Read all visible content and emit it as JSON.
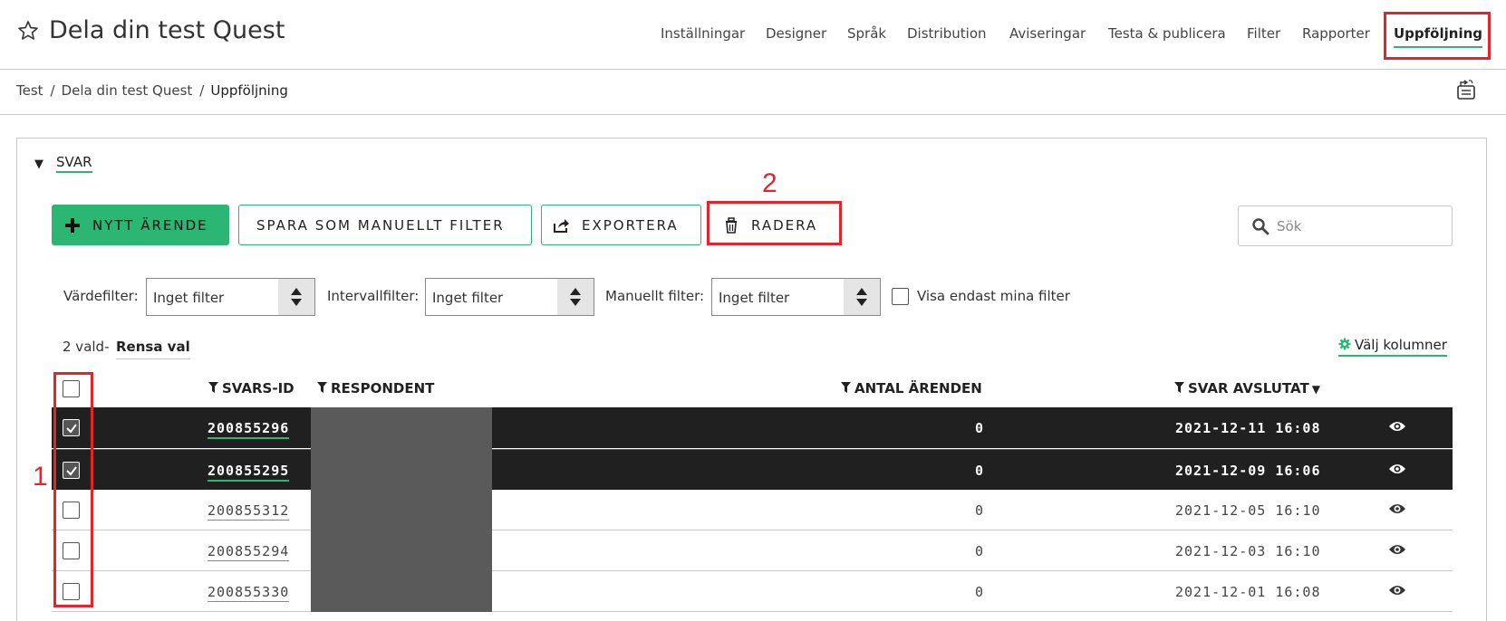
{
  "header": {
    "title": "Dela din test Quest",
    "nav": [
      "Inställningar",
      "Designer",
      "Språk",
      "Distribution",
      "Aviseringar",
      "Testa & publicera",
      "Filter",
      "Rapporter",
      "Uppföljning"
    ],
    "active_nav": "Uppföljning"
  },
  "breadcrumb": [
    "Test",
    "Dela din test Quest",
    "Uppföljning"
  ],
  "breadcrumb_separator": "/",
  "section": {
    "title": "SVAR"
  },
  "annotations": {
    "first": "1",
    "second": "2"
  },
  "toolbar": {
    "new_case": "NYTT ÄRENDE",
    "save_filter": "SPARA SOM MANUELLT FILTER",
    "export": "EXPORTERA",
    "delete": "RADERA"
  },
  "search": {
    "placeholder": "Sök"
  },
  "filters": {
    "value_label": "Värdefilter:",
    "value_selected": "Inget filter",
    "interval_label": "Intervallfilter:",
    "interval_selected": "Inget filter",
    "manual_label": "Manuellt filter:",
    "manual_selected": "Inget filter",
    "only_mine_label": "Visa endast mina filter",
    "only_mine_checked": false
  },
  "selection": {
    "count_text": "2 vald-",
    "clear_label": "Rensa val"
  },
  "columns_link": "Välj kolumner",
  "table": {
    "headers": {
      "id": "SVARS-ID",
      "respondent": "RESPONDENT",
      "cases": "ANTAL ÄRENDEN",
      "finished": "SVAR AVSLUTAT"
    },
    "rows": [
      {
        "id": "200855296",
        "cases": "0",
        "finished": "2021-12-11 16:08",
        "selected": true
      },
      {
        "id": "200855295",
        "cases": "0",
        "finished": "2021-12-09 16:06",
        "selected": true
      },
      {
        "id": "200855312",
        "cases": "0",
        "finished": "2021-12-05 16:10",
        "selected": false
      },
      {
        "id": "200855294",
        "cases": "0",
        "finished": "2021-12-03 16:10",
        "selected": false
      },
      {
        "id": "200855330",
        "cases": "0",
        "finished": "2021-12-01 16:08",
        "selected": false
      }
    ]
  },
  "colors": {
    "accent": "#2bb673",
    "highlight_box": "#e6222a",
    "selected_row": "#202020",
    "redacted": "#5a5a5a"
  }
}
